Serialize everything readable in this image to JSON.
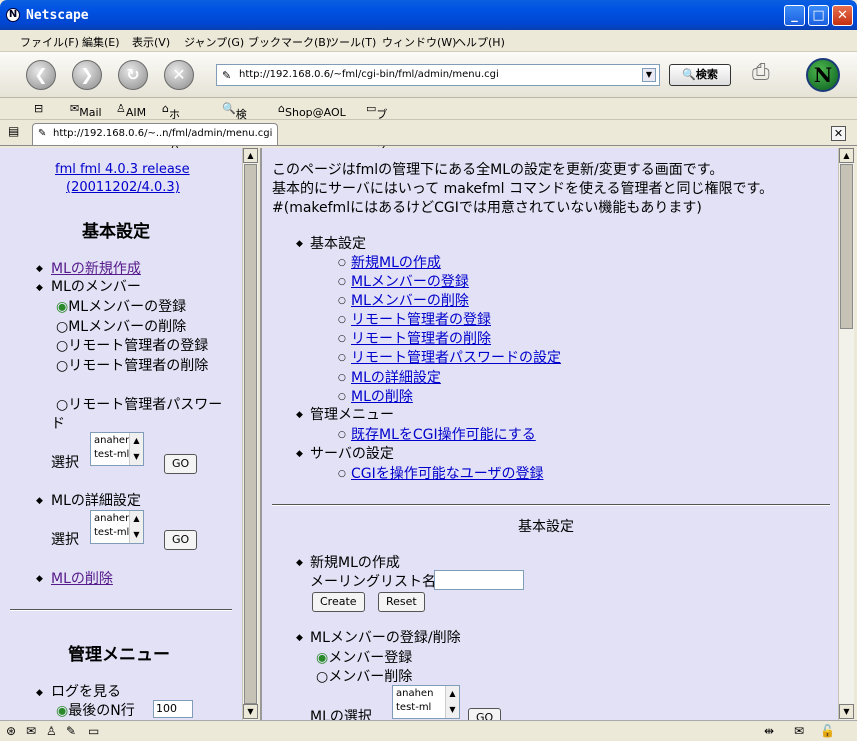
{
  "window": {
    "title": "Netscape"
  },
  "menubar": [
    "ファイル(F)",
    "編集(E)",
    "表示(V)",
    "ジャンプ(G)",
    "ブックマーク(B)",
    "ツール(T)",
    "ウィンドウ(W)",
    "ヘルプ(H)"
  ],
  "nav": {
    "url": "http://192.168.0.6/~fml/cgi-bin/fml/admin/menu.cgi",
    "search_label": "検索",
    "logo": "N"
  },
  "bookmarks": [
    "Mail",
    "AIM",
    "ホーム",
    "検索",
    "Shop@AOL",
    "ブックマーク"
  ],
  "tab": {
    "label": "http://192.168.0.6/~..n/fml/admin/menu.cgi"
  },
  "left": {
    "version_line1": "fml fml 4.0.3 release",
    "version_line2": "(20011202/4.0.3)",
    "heading_basic": "基本設定",
    "link_new_ml": "MLの新規作成",
    "ml_members": "MLのメンバー",
    "radios": [
      "MLメンバーの登録",
      "MLメンバーの削除",
      "リモート管理者の登録",
      "リモート管理者の削除"
    ],
    "radio_password_1": "リモート管理者パスワー",
    "radio_password_2": "ド",
    "select_label": "選択",
    "select_options": [
      "anahen",
      "test-ml"
    ],
    "go_label": "GO",
    "ml_detail": "MLの詳細設定",
    "link_delete_ml": "MLの削除",
    "heading_admin": "管理メニュー",
    "log_view": "ログを見る",
    "last_n": "最後のN行",
    "last_n_value": "100"
  },
  "right": {
    "intro1": "このページはfmlの管理下にある全MLの設定を更新/変更する画面です。",
    "intro2": "基本的にサーバにはいって makefml コマンドを使える管理者と同じ権限です。",
    "intro3": "#(makefmlにはあるけどCGIでは用意されていない機能もあります)",
    "toc_basic": "基本設定",
    "toc_basic_links": [
      "新規MLの作成",
      "MLメンバーの登録",
      "MLメンバーの削除",
      "リモート管理者の登録",
      "リモート管理者の削除",
      "リモート管理者パスワードの設定",
      "MLの詳細設定",
      "MLの削除"
    ],
    "toc_admin": "管理メニュー",
    "toc_admin_link": "既存MLをCGI操作可能にする",
    "toc_server": "サーバの設定",
    "toc_server_link": "CGIを操作可能なユーザの登録",
    "section_title": "基本設定",
    "new_ml_title": "新規MLの作成",
    "ml_name_label": "メーリングリスト名",
    "create_label": "Create",
    "reset_label": "Reset",
    "member_title": "MLメンバーの登録/削除",
    "member_add": "メンバー登録",
    "member_del": "メンバー削除",
    "ml_select_label": "MLの選択",
    "select_options": [
      "anahen",
      "test-ml"
    ],
    "go_label": "GO"
  }
}
